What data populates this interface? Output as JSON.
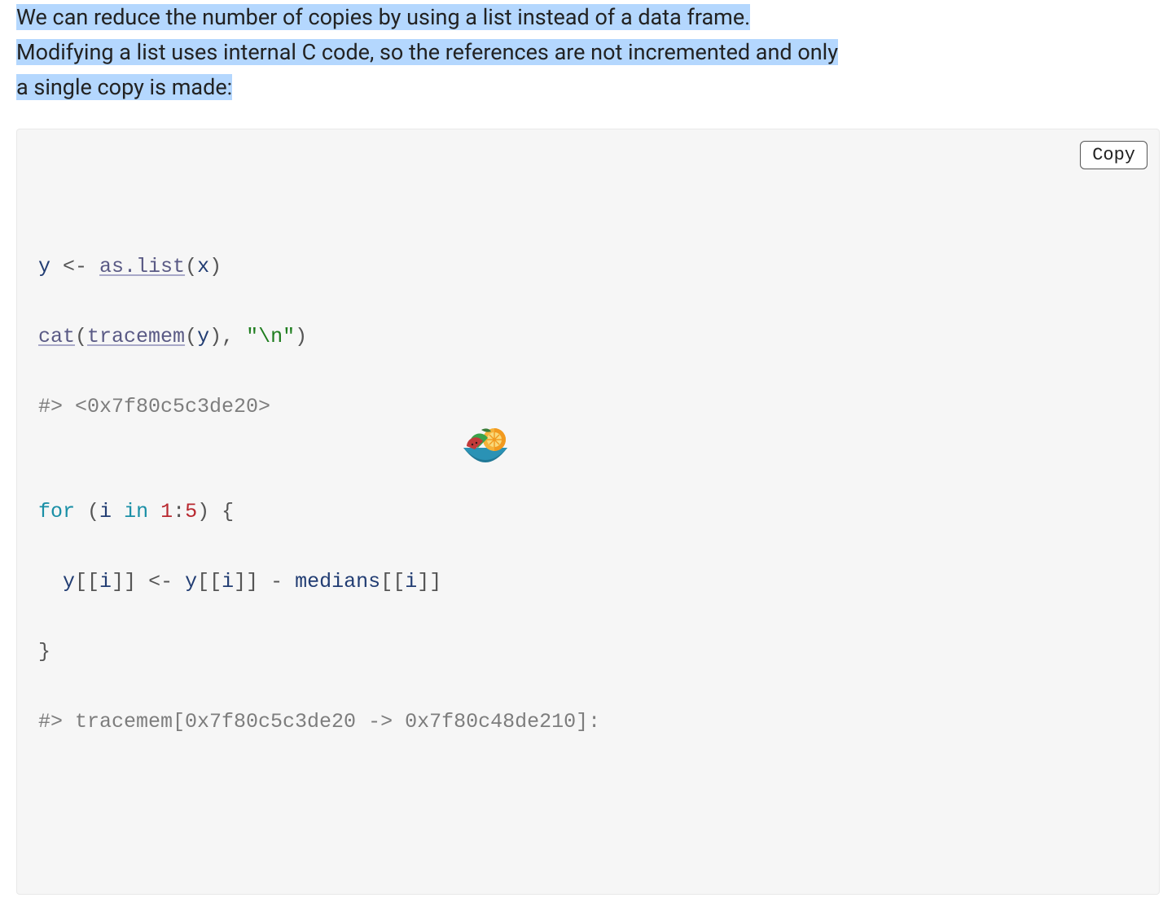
{
  "paragraph": {
    "t1": "We can reduce the number of copies by using a list instead of a data frame.",
    "t2": "Modifying a list uses internal C code, so the references are not incremented and only",
    "t3": "a single copy is made:"
  },
  "copy_label": "Copy",
  "code": {
    "l1": {
      "y": "y",
      "assign": " <- ",
      "fn": "as.list",
      "open": "(",
      "x": "x",
      "close": ")"
    },
    "l2": {
      "cat": "cat",
      "open1": "(",
      "tracemem": "tracemem",
      "open2": "(",
      "y": "y",
      "close2": ")",
      "comma": ", ",
      "str": "\"\\n\"",
      "close1": ")"
    },
    "l3": {
      "comment": "#> <0x7f80c5c3de20>"
    },
    "l4": {
      "blank": ""
    },
    "l5": {
      "for": "for",
      "sp1": " ",
      "open": "(",
      "i": "i",
      "in": " in ",
      "one": "1",
      "colon": ":",
      "five": "5",
      "close": ")",
      "sp2": " ",
      "brace": "{"
    },
    "l6": {
      "indent": "  ",
      "y1": "y",
      "o1": "[[",
      "i1": "i",
      "c1": "]]",
      "assign": " <- ",
      "y2": "y",
      "o2": "[[",
      "i2": "i",
      "c2": "]]",
      "minus": " - ",
      "medians": "medians",
      "o3": "[[",
      "i3": "i",
      "c3": "]]"
    },
    "l7": {
      "brace": "}"
    },
    "l8": {
      "comment": "#> tracemem[0x7f80c5c3de20 -> 0x7f80c48de210]:"
    }
  }
}
